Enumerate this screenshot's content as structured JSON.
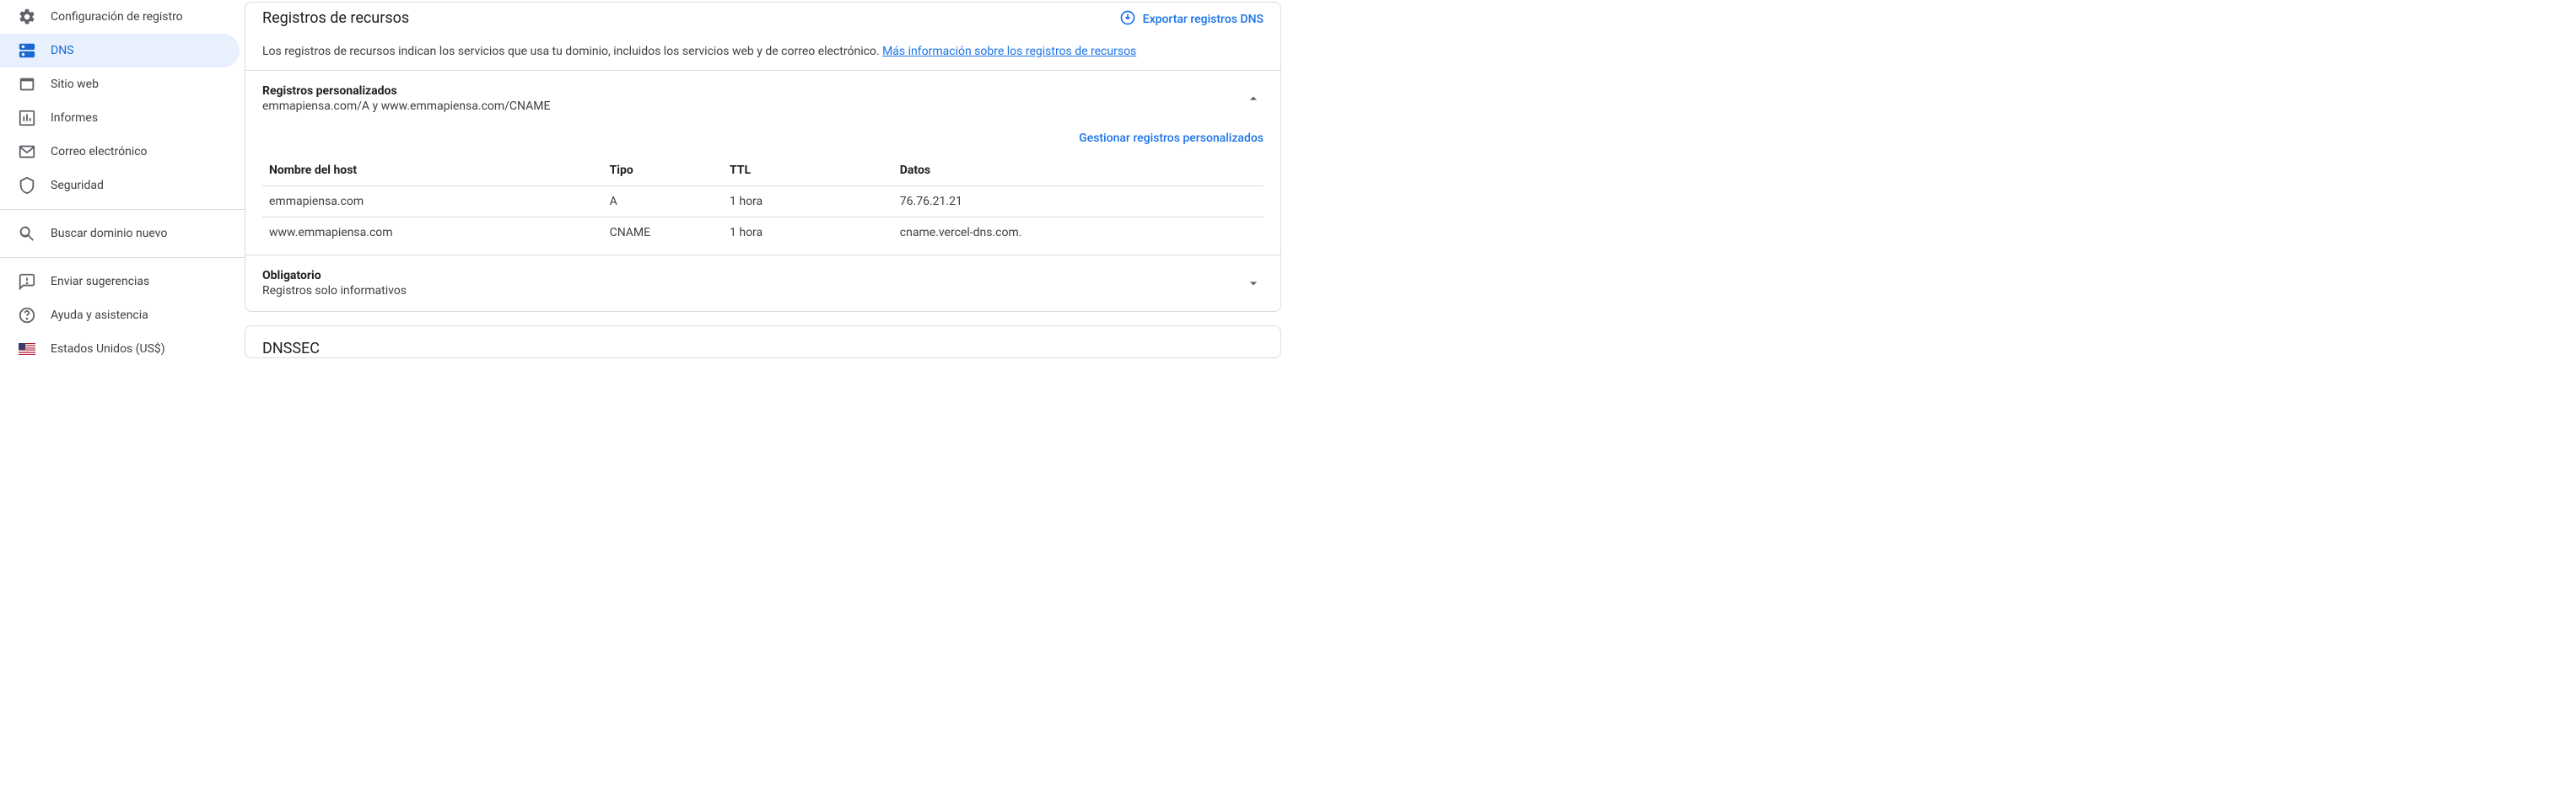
{
  "sidebar": {
    "items": [
      {
        "label": "Configuración de registro"
      },
      {
        "label": "DNS"
      },
      {
        "label": "Sitio web"
      },
      {
        "label": "Informes"
      },
      {
        "label": "Correo electrónico"
      },
      {
        "label": "Seguridad"
      }
    ],
    "search": "Buscar dominio nuevo",
    "footer": [
      {
        "label": "Enviar sugerencias"
      },
      {
        "label": "Ayuda y asistencia"
      },
      {
        "label": "Estados Unidos (US$)"
      }
    ]
  },
  "main": {
    "title": "Registros de recursos",
    "export": "Exportar registros DNS",
    "desc_text": "Los registros de recursos indican los servicios que usa tu dominio, incluidos los servicios web y de correo electrónico. ",
    "desc_link": "Más información sobre los registros de recursos",
    "custom": {
      "title": "Registros personalizados",
      "sub": "emmapiensa.com/A y www.emmapiensa.com/CNAME",
      "manage": "Gestionar registros personalizados",
      "headers": {
        "host": "Nombre del host",
        "type": "Tipo",
        "ttl": "TTL",
        "data": "Datos"
      },
      "rows": [
        {
          "host": "emmapiensa.com",
          "type": "A",
          "ttl": "1 hora",
          "data": "76.76.21.21"
        },
        {
          "host": "www.emmapiensa.com",
          "type": "CNAME",
          "ttl": "1 hora",
          "data": "cname.vercel-dns.com."
        }
      ]
    },
    "required": {
      "title": "Obligatorio",
      "sub": "Registros solo informativos"
    },
    "dnssec": "DNSSEC"
  }
}
